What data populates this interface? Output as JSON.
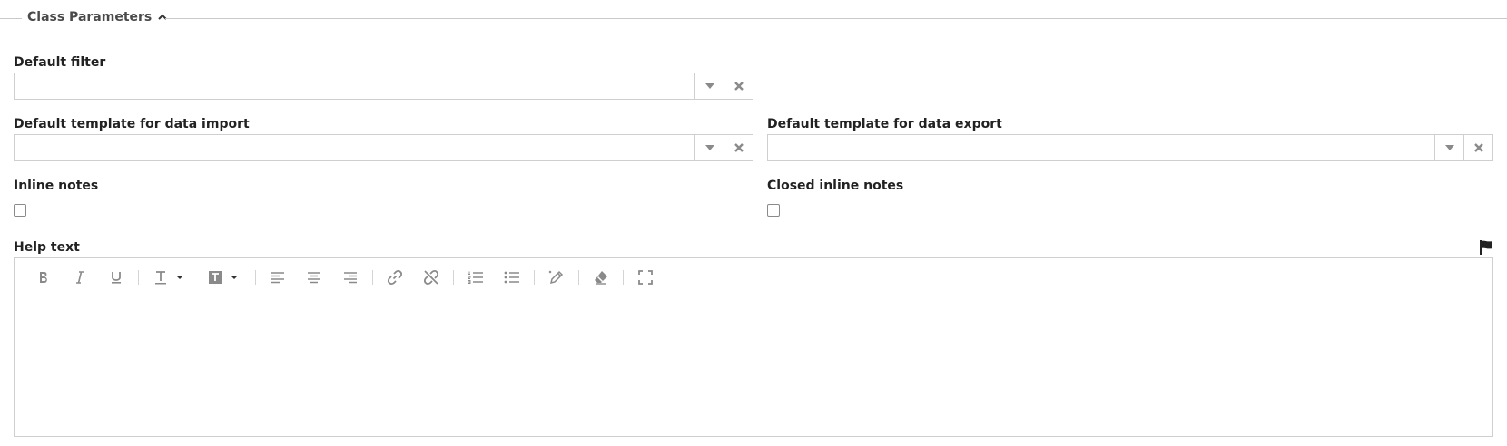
{
  "section": {
    "title": "Class Parameters"
  },
  "fields": {
    "default_filter": {
      "label": "Default filter",
      "value": ""
    },
    "import_template": {
      "label": "Default template for data import",
      "value": ""
    },
    "export_template": {
      "label": "Default template for data export",
      "value": ""
    },
    "inline_notes": {
      "label": "Inline notes",
      "checked": false
    },
    "closed_inline_notes": {
      "label": "Closed inline notes",
      "checked": false
    },
    "help_text": {
      "label": "Help text",
      "content": ""
    }
  },
  "toolbar": {
    "items": [
      "bold",
      "italic",
      "underline",
      "text-color",
      "background-color",
      "align-left",
      "align-center",
      "align-right",
      "link",
      "unlink",
      "ordered-list",
      "unordered-list",
      "edit-source",
      "clear-format",
      "fullscreen"
    ]
  },
  "colors": {
    "icon": "#8a8a8a",
    "border": "#cfcfcf",
    "text": "#222222"
  }
}
